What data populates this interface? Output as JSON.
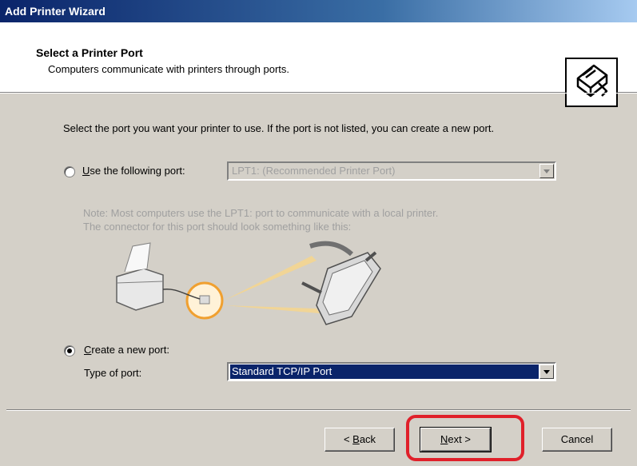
{
  "window": {
    "title": "Add Printer Wizard"
  },
  "header": {
    "title": "Select a Printer Port",
    "subtitle": "Computers communicate with printers through ports.",
    "icon": "printer-port-icon"
  },
  "main": {
    "intro": "Select the port you want your printer to use.  If the port is not listed, you can create a new port.",
    "use_port": {
      "label_key": "U",
      "label_rest": "se the following port:",
      "value": "LPT1: (Recommended Printer Port)",
      "selected": false
    },
    "note_line1": "Note: Most computers use the LPT1: port to communicate with a local printer.",
    "note_line2": "The connector for this port should look something like this:",
    "create_port": {
      "label_key": "C",
      "label_rest": "reate a new port:",
      "selected": true,
      "type_label": "Type of port:",
      "type_value": "Standard TCP/IP Port"
    }
  },
  "footer": {
    "back_prefix": "< ",
    "back_key": "B",
    "back_rest": "ack",
    "next_key": "N",
    "next_rest": "ext >",
    "cancel_label": "Cancel"
  },
  "colors": {
    "accent": "#0a246a",
    "highlight": "#e0202a",
    "illustration": "#f0a030"
  }
}
